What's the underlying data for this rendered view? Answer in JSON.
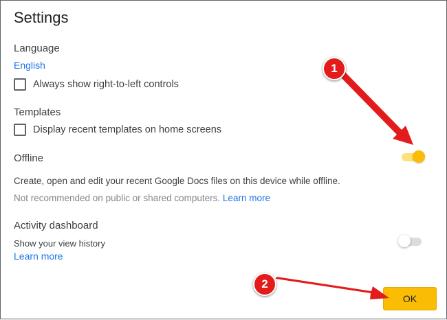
{
  "dialog": {
    "title": "Settings"
  },
  "language": {
    "heading": "Language",
    "current": "English",
    "rtl_checkbox_label": "Always show right-to-left controls",
    "rtl_checked": false
  },
  "templates": {
    "heading": "Templates",
    "checkbox_label": "Display recent templates on home screens",
    "checked": false
  },
  "offline": {
    "heading": "Offline",
    "enabled": true,
    "description": "Create, open and edit your recent Google Docs files on this device while offline.",
    "note": "Not recommended on public or shared computers.",
    "learn_more": "Learn more"
  },
  "activity": {
    "heading": "Activity dashboard",
    "description": "Show your view history",
    "enabled": false,
    "learn_more": "Learn more"
  },
  "buttons": {
    "ok": "OK"
  },
  "annotations": [
    {
      "number": "1"
    },
    {
      "number": "2"
    }
  ],
  "colors": {
    "accent_yellow": "#fbbc04",
    "link_blue": "#1a73e8",
    "annotation_red": "#e31b1b"
  }
}
